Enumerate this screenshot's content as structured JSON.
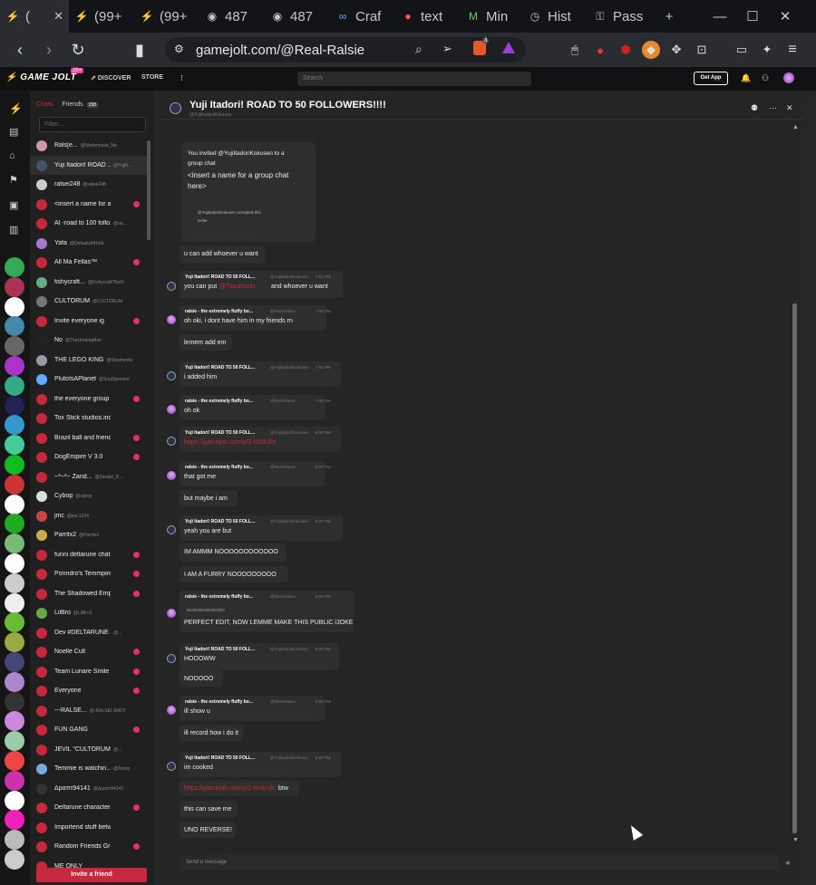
{
  "browser": {
    "tabs": [
      {
        "label": "(",
        "icon": "gamejolt-icon"
      },
      {
        "label": "(99+",
        "icon": "gamejolt-icon"
      },
      {
        "label": "(99+",
        "icon": "gamejolt-icon"
      },
      {
        "label": "487",
        "icon": "globe-icon"
      },
      {
        "label": "487",
        "icon": "globe-icon"
      },
      {
        "label": "Craf",
        "icon": "craft-icon"
      },
      {
        "label": "text",
        "icon": "text-icon"
      },
      {
        "label": "Min",
        "icon": "min-icon"
      },
      {
        "label": "Hist",
        "icon": "history-icon"
      },
      {
        "label": "Pass",
        "icon": "key-icon"
      }
    ],
    "new_tab": "+",
    "url": "gamejolt.com/@Real-Ralsie",
    "badge": "3"
  },
  "gj": {
    "logo": "GAME JOLT",
    "logo_badge": "20+",
    "discover": "DISCOVER",
    "store": "STORE",
    "more": "⋮",
    "search_placeholder": "Search",
    "get_app": "Get App"
  },
  "chatlist": {
    "tab_chats": "Chats",
    "tab_friends": "Friends",
    "friends_count": "158",
    "filter_placeholder": "Filter...",
    "invite": "Invite a friend",
    "items": [
      {
        "name": "Rals[e...",
        "handle": "@Stickmouse_Nexsarpe...",
        "color": "#c9a",
        "unread": false
      },
      {
        "name": "Yuji Itadori! ROAD ...",
        "handle": "@YujiIt...",
        "color": "#456",
        "unread": false,
        "selected": true
      },
      {
        "name": "ralsei248",
        "handle": "@ralsei248",
        "color": "#ccc",
        "unread": false
      },
      {
        "name": "<insert a name for a gr...",
        "handle": "",
        "color": "#c8283e",
        "unread": true
      },
      {
        "name": "AI -road to 100 follo...",
        "handle": "@an...",
        "color": "#c8283e",
        "unread": false
      },
      {
        "name": "Yafa",
        "handle": "@DeltaduAfHafa",
        "color": "#a7c",
        "unread": false
      },
      {
        "name": "All Ma Fellas™",
        "handle": "",
        "color": "#c8283e",
        "unread": true
      },
      {
        "name": "fishycraft...",
        "handle": "@FishycraftTheFish...",
        "color": "#6a8",
        "unread": false
      },
      {
        "name": "CULTORUM",
        "handle": "@CULTORUM",
        "color": "#777",
        "unread": false
      },
      {
        "name": "Invite everyone ig",
        "handle": "",
        "color": "#c8283e",
        "unread": true
      },
      {
        "name": "No",
        "handle": "@TheUndeadAnima",
        "color": "#222",
        "unread": false
      },
      {
        "name": "THE LEGO KING",
        "handle": "@Stephenite",
        "color": "#99a",
        "unread": false
      },
      {
        "name": "PlutoIsAPlanet",
        "handle": "@SoulSpenner",
        "color": "#6af",
        "unread": false
      },
      {
        "name": "the everyone group 4:...",
        "handle": "",
        "color": "#c8283e",
        "unread": true
      },
      {
        "name": "Tox Stick studios.inc (GJ Edi...",
        "handle": "",
        "color": "#c8283e",
        "unread": false
      },
      {
        "name": "Brazil ball and friends",
        "handle": "",
        "color": "#c8283e",
        "unread": true
      },
      {
        "name": "DogEmpire V 3.0",
        "handle": "",
        "color": "#c8283e",
        "unread": true
      },
      {
        "name": "~*~*~ Zand...",
        "handle": "@Zandal_R...",
        "color": "#c8283e",
        "unread": false
      },
      {
        "name": "Cybop",
        "handle": "@cybop",
        "color": "#ddd",
        "unread": false
      },
      {
        "name": "jmc",
        "handle": "@jmc1234",
        "color": "#c44",
        "unread": false
      },
      {
        "name": "Parritx2",
        "handle": "@Parritx2",
        "color": "#ca4",
        "unread": false
      },
      {
        "name": "funni deltarune chat",
        "handle": "",
        "color": "#c8283e",
        "unread": true
      },
      {
        "name": "Ponndro's Temmpire C...",
        "handle": "",
        "color": "#c8283e",
        "unread": true
      },
      {
        "name": "The Shadowed Empire",
        "handle": "",
        "color": "#c8283e",
        "unread": true
      },
      {
        "name": "LilBro",
        "handle": "@LilBro1",
        "color": "#6a4",
        "unread": false
      },
      {
        "name": "Dev #DELTARUNE #U...",
        "handle": "@...",
        "color": "#c8283e",
        "unread": false
      },
      {
        "name": "Noelle Cult",
        "handle": "",
        "color": "#c8283e",
        "unread": true
      },
      {
        "name": "Team Lunare Smile to ...",
        "handle": "",
        "color": "#c8283e",
        "unread": true
      },
      {
        "name": "Everyone",
        "handle": "",
        "color": "#c8283e",
        "unread": true
      },
      {
        "name": "---RALSE...",
        "handle": "@-RALSEI-SNOTSR...",
        "color": "#c8283e",
        "unread": false
      },
      {
        "name": "FUN GANG",
        "handle": "",
        "color": "#c8283e",
        "unread": true
      },
      {
        "name": "JEVIL \"CULTORUM\" B...",
        "handle": "@...",
        "color": "#c8283e",
        "unread": false
      },
      {
        "name": "Temmie is watchin...",
        "handle": "@Temlo",
        "color": "#7ad",
        "unread": false
      },
      {
        "name": "Δραπτ94141",
        "handle": "@Δραπτ94141",
        "color": "#333",
        "unread": false
      },
      {
        "name": "Deltarune characters g...",
        "handle": "",
        "color": "#c8283e",
        "unread": true
      },
      {
        "name": "Importend stuff between m...",
        "handle": "",
        "color": "#c8283e",
        "unread": false
      },
      {
        "name": "Random Friends Grou...",
        "handle": "",
        "color": "#c8283e",
        "unread": true
      },
      {
        "name": "ME ONLY",
        "handle": "",
        "color": "#c8283e",
        "unread": false
      }
    ]
  },
  "chat": {
    "title": "Yuji Itadori! ROAD TO 50 FOLLOWERS!!!!",
    "subtitle": "@YujiItadoriKokusen",
    "invite_card": {
      "line1": "You invited @YujiItadoriKokusen to a",
      "line2": "group chat",
      "name1": "<insert a name for a group chat",
      "name2": "here>",
      "accepted1": "@YujiItadoriKokusen accepted this",
      "accepted2": "invite."
    },
    "composer_placeholder": "Send a message",
    "messages": [
      {
        "text": "u can add whoever u want"
      },
      {
        "name": "Yuji Itadori! ROAD TO 50 FOLL...",
        "handle": "@YujiItadoriKokusen",
        "time": "7:53 PM",
        "text": "you can put",
        "tail": "and whoever u want",
        "mention": "@Toastracer"
      },
      {
        "name": "ralsie - the extremely fluffy bo...",
        "handle": "@Real-Ralsie",
        "time": "7:54 PM",
        "text": "oh oki, i dont have him in my friends rn"
      },
      {
        "text": "lemem add em"
      },
      {
        "name": "Yuji Itadori! ROAD TO 50 FOLL...",
        "handle": "@YujiItadoriKokusen",
        "time": "7:54 PM",
        "text": "i added him"
      },
      {
        "name": "ralsie - the extremely fluffy bo...",
        "handle": "@Real-Ralsie",
        "time": "7:55 PM",
        "text": "oh ok"
      },
      {
        "name": "Yuji Itadori! ROAD TO 50 FOLL...",
        "handle": "@YujiItadoriKokusen",
        "time": "8:09 PM",
        "text": "https://gamejolt.com/p/3-hZdUlm"
      },
      {
        "name": "ralsie - the extremely fluffy bo...",
        "handle": "@Real-Ralsie",
        "time": "8:07 PM",
        "text": "that got me"
      },
      {
        "text": "but maybe i am"
      },
      {
        "name": "Yuji Itadori! ROAD TO 50 FOLL...",
        "handle": "@YujiItadoriKokusen",
        "time": "8:07 PM",
        "text": "yeah you are but"
      },
      {
        "text": "IM AMMM NOOOOOOOOOOOO"
      },
      {
        "text": "I AM A FURRY NOOOOOOOOO"
      },
      {
        "name": "ralsie - the extremely fluffy bo...",
        "handle": "@Real-Ralsie",
        "time": "8:08 PM",
        "text": "PERFECT EDIT, NOW LEMME MAKE THIS PUBLIC /JOKE",
        "quote": "NOOOOOOOOOOO"
      },
      {
        "name": "Yuji Itadori! ROAD TO 50 FOLL...",
        "handle": "@YujiItadoriKokusen",
        "time": "8:08 PM",
        "text": "HOOOWW"
      },
      {
        "text": "NOOOOO"
      },
      {
        "name": "ralsie - the extremely fluffy bo...",
        "handle": "@Real-Ralsie",
        "time": "8:08 PM",
        "text": "ill show u"
      },
      {
        "text": "ill record how i do it"
      },
      {
        "name": "Yuji Itadori! ROAD TO 50 FOLL...",
        "handle": "@YujiItadoriKokusen",
        "time": "9:09 PM",
        "text": "im cooked"
      },
      {
        "text": "https://gamejolt.com/p/2-nh9zvh",
        "tail": "btw"
      },
      {
        "text": "this can save me"
      },
      {
        "text": "UNO REVERSE!"
      }
    ]
  }
}
